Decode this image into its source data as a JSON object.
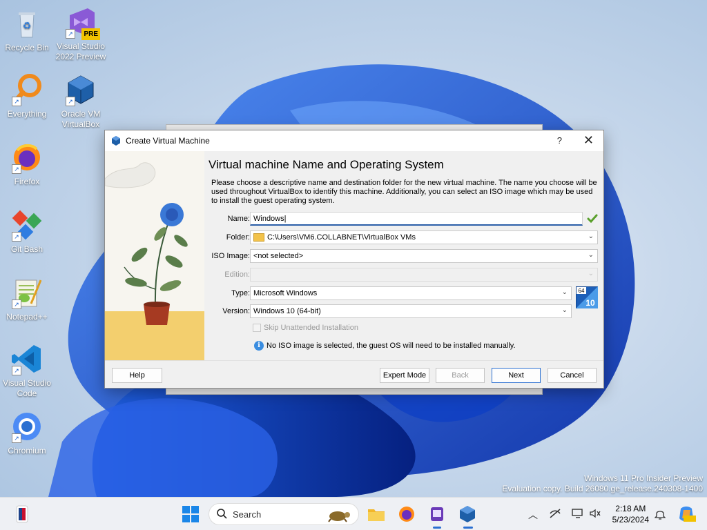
{
  "desktop": {
    "icons": [
      {
        "label": "Recycle Bin"
      },
      {
        "label": "Visual Studio 2022 Preview",
        "badge": "PRE"
      },
      {
        "label": "Everything"
      },
      {
        "label": "Oracle VM VirtualBox"
      },
      {
        "label": "Firefox"
      },
      {
        "label": "Git Bash"
      },
      {
        "label": "Notepad++"
      },
      {
        "label": "Visual Studio Code"
      },
      {
        "label": "Chromium"
      }
    ],
    "watermark_line1": "Windows 11 Pro Insider Preview",
    "watermark_line2": "Evaluation copy. Build 26080.ge_release.240308-1400"
  },
  "dialog": {
    "title": "Create Virtual Machine",
    "help_glyph": "?",
    "close_glyph": "✕",
    "heading": "Virtual machine Name and Operating System",
    "description": "Please choose a descriptive name and destination folder for the new virtual machine. The name you choose will be used throughout VirtualBox to identify this machine. Additionally, you can select an ISO image which may be used to install the guest operating system.",
    "fields": {
      "name_label": "Name:",
      "name_value": "Windows",
      "folder_label": "Folder:",
      "folder_value": "C:\\Users\\VM6.COLLABNET\\VirtualBox VMs",
      "iso_label": "ISO Image:",
      "iso_value": "<not selected>",
      "edition_label": "Edition:",
      "edition_value": "",
      "type_label": "Type:",
      "type_value": "Microsoft Windows",
      "version_label": "Version:",
      "version_value": "Windows 10 (64-bit)",
      "os_badge_top": "64",
      "os_badge_num": "10"
    },
    "skip_unattended_label": "Skip Unattended Installation",
    "info_note": "No ISO image is selected, the guest OS will need to be installed manually.",
    "buttons": {
      "help": "Help",
      "expert": "Expert Mode",
      "back": "Back",
      "next": "Next",
      "cancel": "Cancel"
    }
  },
  "taskbar": {
    "search_placeholder": "Search",
    "clock_time": "2:18 AM",
    "clock_date": "5/23/2024"
  },
  "colors": {
    "accent": "#2a6fd1",
    "dialog_bg": "#f0f0f0",
    "taskbar_bg": "#eef0f4"
  }
}
